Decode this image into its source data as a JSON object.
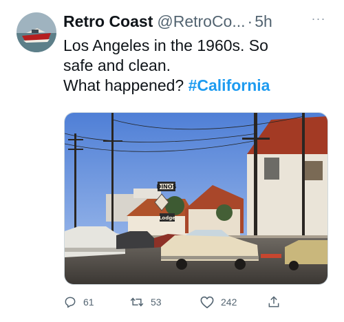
{
  "tweet": {
    "author_name": "Retro Coast",
    "author_handle": "@RetroCo...",
    "separator": "·",
    "time": "5h",
    "text_line1": "Los Angeles in the 1960s. So",
    "text_line2": "safe and clean.",
    "text_line3": "What happened?",
    "hashtag": "#California",
    "more_glyph": "···",
    "photo": {
      "signs": {
        "dinos": "DINOS",
        "lodge": "Lodge"
      }
    },
    "actions": {
      "replies": "61",
      "retweets": "53",
      "likes": "242"
    }
  },
  "colors": {
    "text": "#0f1419",
    "secondary": "#536471",
    "link": "#1d9bf0"
  },
  "icons": [
    "more-icon",
    "reply-icon",
    "retweet-icon",
    "like-icon",
    "share-icon"
  ]
}
